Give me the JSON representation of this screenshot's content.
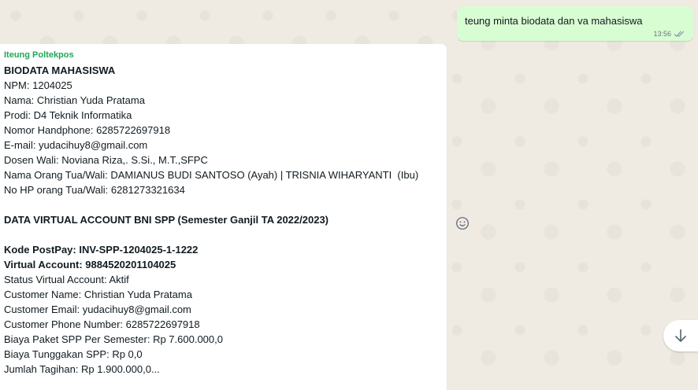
{
  "outgoing": {
    "text": "teung minta biodata dan va mahasiswa",
    "time": "13:56",
    "status_icon": "double-check-icon"
  },
  "incoming": {
    "sender": "Iteung Poltekpos",
    "lines": [
      "BIODATA MAHASISWA",
      "NPM: 1204025",
      "Nama: Christian Yuda Pratama",
      "Prodi: D4 Teknik Informatika",
      "Nomor Handphone: 6285722697918",
      "E-mail: yudacihuy8@gmail.com",
      "Dosen Wali: Noviana Riza,. S.Si., M.T.,SFPC",
      "Nama Orang Tua/Wali: DAMIANUS BUDI SANTOSO (Ayah) | TRISNIA WIHARYANTI  (Ibu)",
      "No HP orang Tua/Wali: 6281273321634",
      "",
      "DATA VIRTUAL ACCOUNT BNI SPP (Semester Ganjil TA 2022/2023)",
      "",
      "Kode PostPay: INV-SPP-1204025-1-1222",
      "Virtual Account: 9884520201104025",
      "Status Virtual Account: Aktif",
      "Customer Name: Christian Yuda Pratama",
      "Customer Email: yudacihuy8@gmail.com",
      "Customer Phone Number: 6285722697918",
      "Biaya Paket SPP Per Semester: Rp 7.600.000,0",
      "Biaya Tunggakan SPP: Rp 0,0",
      "Jumlah Tagihan: Rp 1.900.000,0..."
    ]
  },
  "icons": {
    "emoji": "emoji-icon",
    "scroll": "arrow-down-icon"
  },
  "colors": {
    "outgoing_bubble": "#d9fdd3",
    "incoming_bubble": "#ffffff",
    "sender_name": "#1fa855",
    "chat_background": "#efeae2"
  }
}
